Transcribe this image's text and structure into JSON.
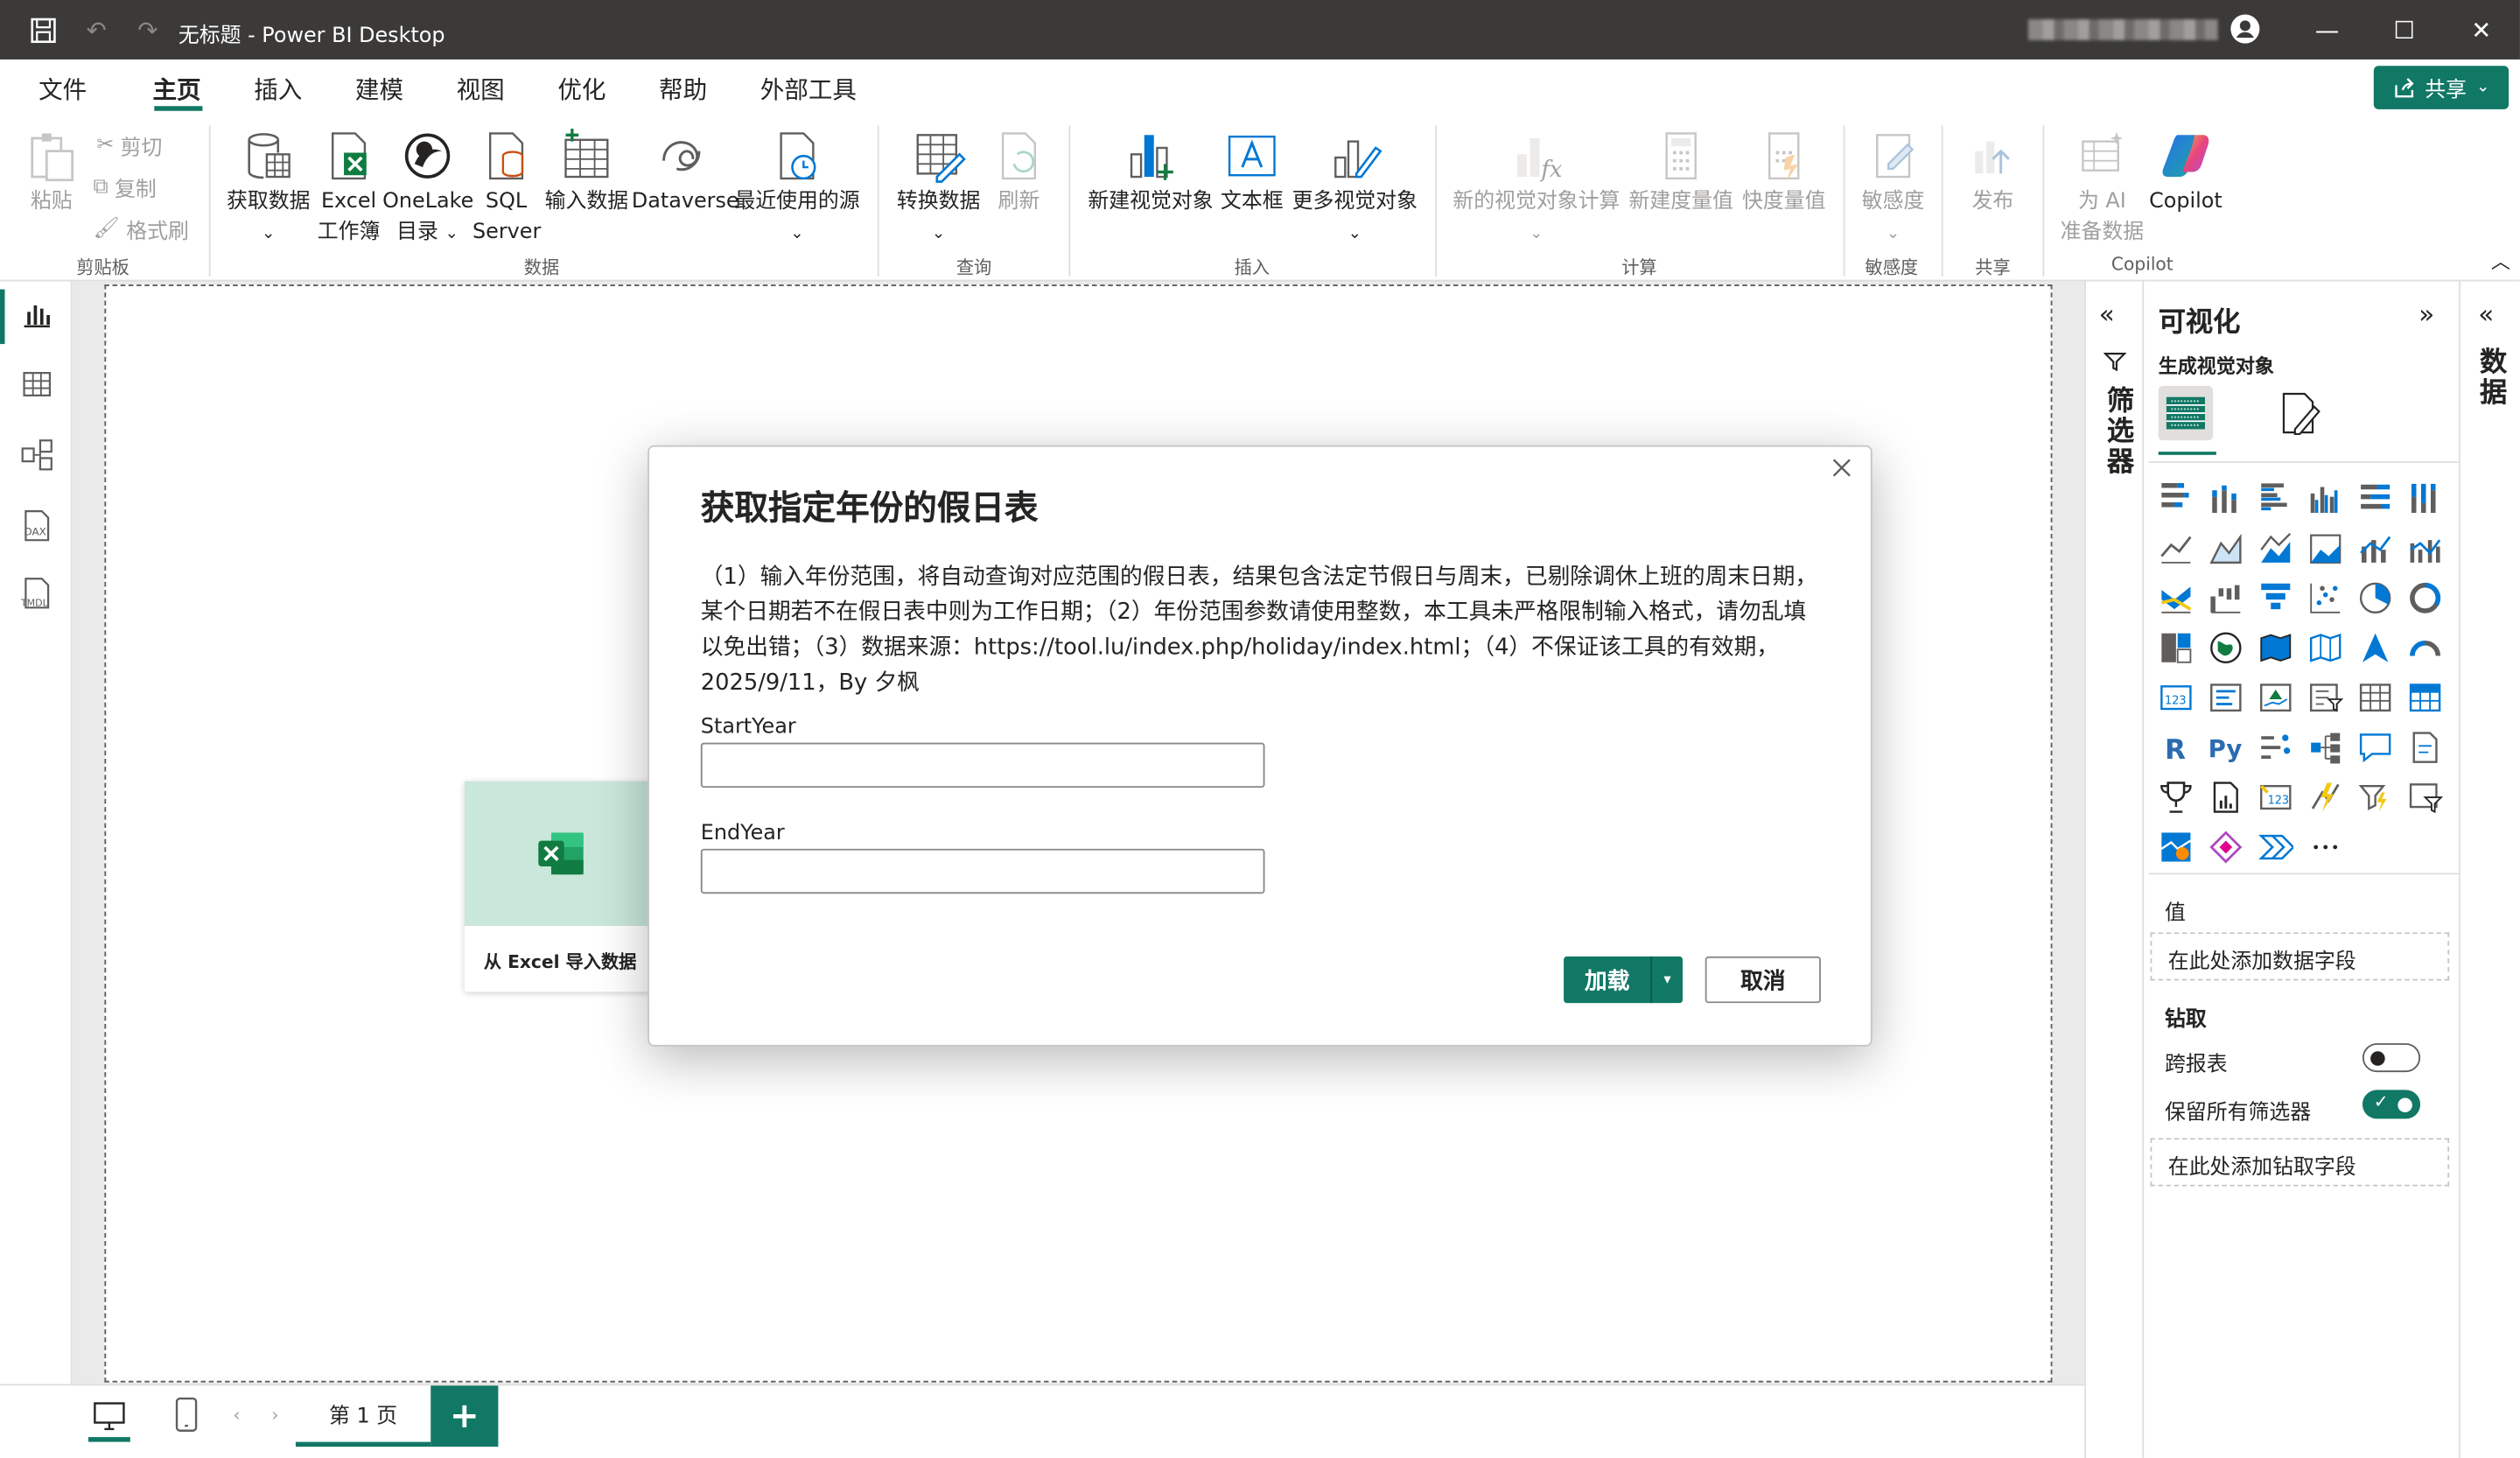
{
  "titlebar": {
    "title": "无标题 - Power BI Desktop"
  },
  "menu": {
    "items": [
      "文件",
      "主页",
      "插入",
      "建模",
      "视图",
      "优化",
      "帮助",
      "外部工具"
    ],
    "active": "主页",
    "share_label": "共享"
  },
  "ribbon": {
    "clipboard": {
      "paste": "粘贴",
      "cut": "剪切",
      "copy": "复制",
      "format_painter": "格式刷",
      "group": "剪贴板"
    },
    "data": {
      "get_data": "获取数据",
      "excel_1": "Excel",
      "excel_2": "工作簿",
      "onelake_1": "OneLake",
      "onelake_2": "目录",
      "sql_1": "SQL",
      "sql_2": "Server",
      "enter_data": "输入数据",
      "dataverse": "Dataverse",
      "recent": "最近使用的源",
      "group": "数据"
    },
    "query": {
      "transform": "转换数据",
      "refresh": "刷新",
      "group": "查询"
    },
    "insert": {
      "new_visual": "新建视觉对象",
      "textbox": "文本框",
      "more_visuals": "更多视觉对象",
      "group": "插入"
    },
    "calc": {
      "new_visual_calc": "新的视觉对象计算",
      "new_measure": "新建度量值",
      "quick_measure": "快度量值",
      "group": "计算"
    },
    "sensitivity": {
      "label": "敏感度",
      "group": "敏感度"
    },
    "share": {
      "publish": "发布",
      "group": "共享"
    },
    "copilot": {
      "ai_1": "为 AI",
      "ai_2": "准备数据",
      "copilot": "Copilot",
      "group": "Copilot"
    }
  },
  "canvas": {
    "excel_card_label": "从 Excel 导入数据"
  },
  "pages": {
    "tab_label": "第 1 页",
    "add": "+"
  },
  "filters": {
    "label": "筛选器"
  },
  "viz": {
    "title": "可视化",
    "subtitle": "生成视觉对象",
    "values_label": "值",
    "values_placeholder": "在此处添加数据字段",
    "drill_label": "钻取",
    "cross_report": "跨报表",
    "cross_report_on": false,
    "keep_filters": "保留所有筛选器",
    "keep_filters_on": true,
    "drill_placeholder": "在此处添加钻取字段"
  },
  "data_pane": {
    "label": "数据"
  },
  "dialog": {
    "title": "获取指定年份的假日表",
    "description": "（1）输入年份范围，将自动查询对应范围的假日表，结果包含法定节假日与周末，已剔除调休上班的周末日期，某个日期若不在假日表中则为工作日期；（2）年份范围参数请使用整数，本工具未严格限制输入格式，请勿乱填以免出错；（3）数据来源：https://tool.lu/index.php/holiday/index.html；（4）不保证该工具的有效期，2025/9/11，By 夕枫",
    "start_label": "StartYear",
    "start_value": "",
    "end_label": "EndYear",
    "end_value": "",
    "load_label": "加载",
    "cancel_label": "取消"
  },
  "colors": {
    "accent": "#117865",
    "titlebar": "#3b3a39"
  }
}
